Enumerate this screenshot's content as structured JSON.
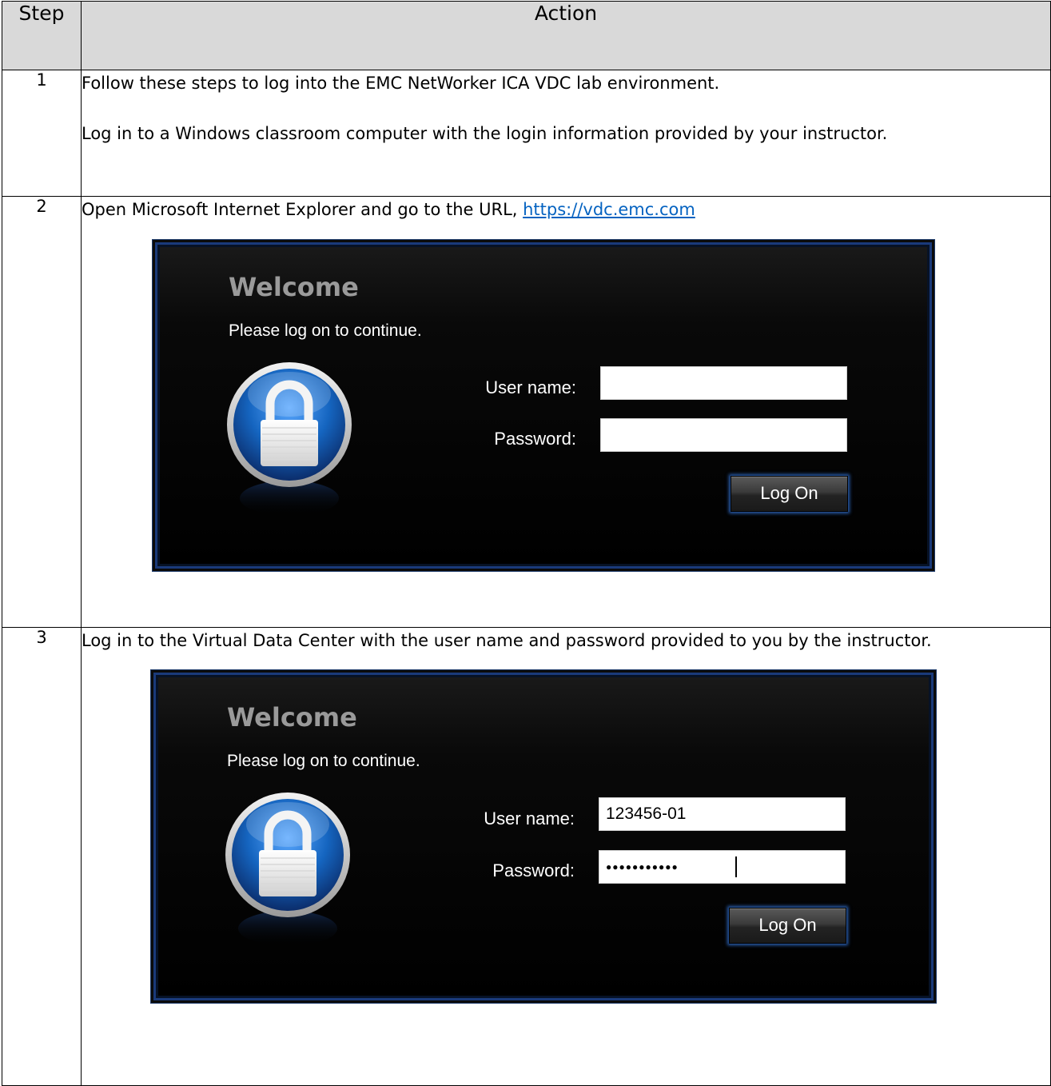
{
  "table": {
    "headers": {
      "step": "Step",
      "action": "Action"
    },
    "rows": [
      {
        "num": "1",
        "paragraphs": [
          "Follow these steps to log into the EMC NetWorker ICA VDC lab environment.",
          "Log in to a Windows classroom computer with the login information provided by your instructor."
        ]
      },
      {
        "num": "2",
        "text": "Open Microsoft Internet Explorer and go to the URL, ",
        "link": "https://vdc.emc.com"
      },
      {
        "num": "3",
        "text": "Log in to the Virtual Data Center with the user name and password provided to you by the instructor."
      }
    ]
  },
  "login_empty": {
    "title": "Welcome",
    "subtitle": "Please log on to continue.",
    "username_label": "User name:",
    "password_label": "Password:",
    "username_value": "",
    "password_value": "",
    "button": "Log On"
  },
  "login_filled": {
    "title": "Welcome",
    "subtitle": "Please log on to continue.",
    "username_label": "User name:",
    "password_label": "Password:",
    "username_value": "123456-01",
    "password_value": "●●●●●●●●●●●",
    "button": "Log On"
  },
  "colors": {
    "header_bg": "#d9d9d9",
    "link": "#0563c1",
    "dialog_bg": "#000000",
    "dialog_border": "#1a3a7a",
    "lock_blue": "#1565c0",
    "button_glow": "#2a5fb0"
  },
  "icons": {
    "lock": "padlock-icon"
  }
}
